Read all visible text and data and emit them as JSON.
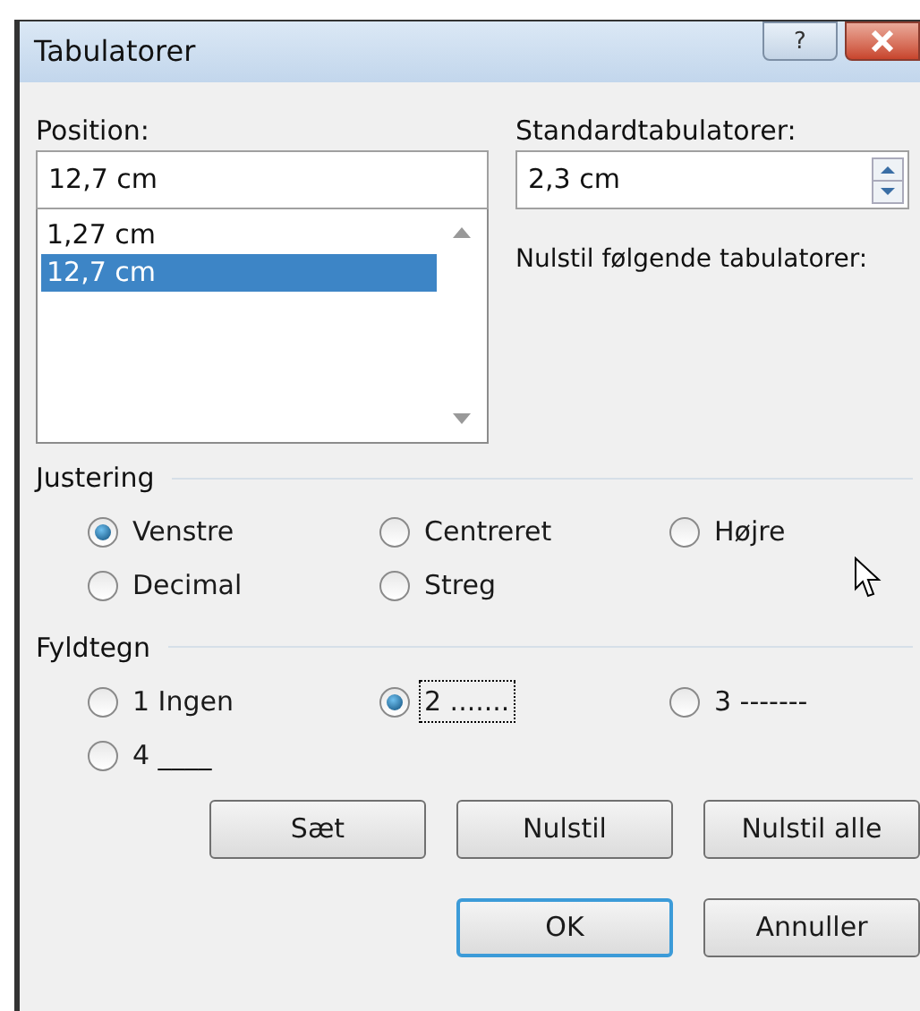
{
  "window": {
    "title": "Tabulatorer",
    "help": "?"
  },
  "position": {
    "label": "Position:",
    "value": "12,7 cm",
    "items": [
      {
        "text": "1,27 cm",
        "selected": false
      },
      {
        "text": "12,7 cm",
        "selected": true
      }
    ]
  },
  "default_tabs": {
    "label": "Standardtabulatorer:",
    "value": "2,3 cm"
  },
  "clear_label": "Nulstil følgende tabulatorer:",
  "alignment": {
    "title": "Justering",
    "options": [
      {
        "label": "Venstre",
        "selected": true
      },
      {
        "label": "Centreret",
        "selected": false
      },
      {
        "label": "Højre",
        "selected": false
      },
      {
        "label": "Decimal",
        "selected": false
      },
      {
        "label": "Streg",
        "selected": false
      }
    ]
  },
  "leader": {
    "title": "Fyldtegn",
    "options": [
      {
        "label": "1 Ingen",
        "selected": false,
        "focused": false
      },
      {
        "label": "2 .......",
        "selected": true,
        "focused": true
      },
      {
        "label": "3 -------",
        "selected": false,
        "focused": false
      },
      {
        "label": "4 ____",
        "selected": false,
        "focused": false
      }
    ]
  },
  "action_buttons": [
    {
      "label": "Sæt",
      "default": false
    },
    {
      "label": "Nulstil",
      "default": false
    },
    {
      "label": "Nulstil alle",
      "default": false
    }
  ],
  "dialog_buttons": [
    {
      "label": "OK",
      "default": true
    },
    {
      "label": "Annuller",
      "default": false
    }
  ]
}
